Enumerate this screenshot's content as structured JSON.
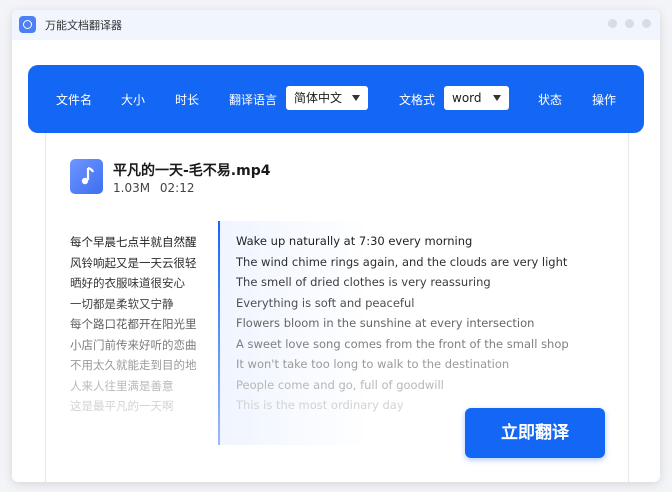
{
  "window": {
    "title": "万能文档翻译器"
  },
  "header": {
    "col_filename": "文件名",
    "col_size": "大小",
    "col_duration": "时长",
    "col_lang": "翻译语言",
    "lang_selected": "简体中文",
    "col_format": "文格式",
    "format_selected": "word",
    "col_status": "状态",
    "col_action": "操作"
  },
  "file": {
    "icon": "music-note-icon",
    "name": "平凡的一天-毛不易.mp4",
    "size": "1.03M",
    "duration": "02:12"
  },
  "lyrics": {
    "zh": [
      "每个早晨七点半就自然醒",
      "风铃响起又是一天云很轻",
      "晒好的衣服味道很安心",
      "一切都是柔软又宁静",
      "每个路口花都开在阳光里",
      "小店门前传来好听的恋曲",
      "不用太久就能走到目的地",
      "人来人往里满是善意",
      "这是最平凡的一天啊"
    ],
    "en": [
      "Wake up naturally at 7:30 every morning",
      "The wind chime rings again, and the clouds are very light",
      "The smell of dried clothes is very reassuring",
      "Everything is soft and peaceful",
      "Flowers bloom in the sunshine at every intersection",
      "A sweet love song comes from the front of the small shop",
      "It won't take too long to walk to the destination",
      "People come and go, full of goodwill",
      "This is the most ordinary day"
    ]
  },
  "actions": {
    "translate_label": "立即翻译"
  },
  "colors": {
    "accent": "#1467f5",
    "titlebar_bg": "#f1f5fd"
  }
}
